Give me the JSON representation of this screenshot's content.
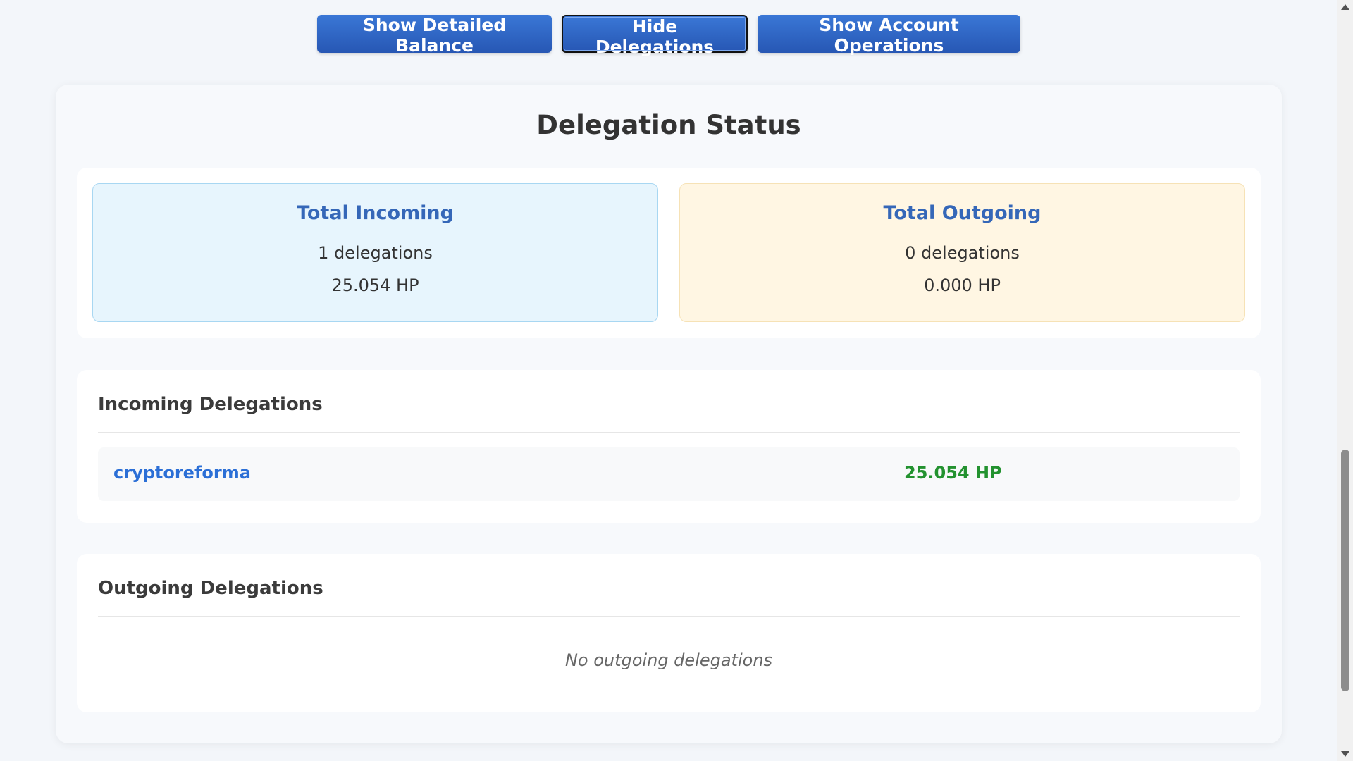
{
  "toolbar": {
    "detailed_balance_label": "Show Detailed Balance",
    "delegations_label": "Hide Delegations",
    "account_operations_label": "Show Account Operations"
  },
  "panel": {
    "title": "Delegation Status"
  },
  "summary": {
    "incoming": {
      "title": "Total Incoming",
      "count": "1 delegations",
      "amount": "25.054 HP"
    },
    "outgoing": {
      "title": "Total Outgoing",
      "count": "0 delegations",
      "amount": "0.000 HP"
    }
  },
  "incoming_section": {
    "title": "Incoming Delegations",
    "rows": [
      {
        "account": "cryptoreforma",
        "amount": "25.054 HP"
      }
    ]
  },
  "outgoing_section": {
    "title": "Outgoing Delegations",
    "empty_text": "No outgoing delegations"
  },
  "colors": {
    "button_primary": "#2f66c5",
    "incoming_card_bg": "#e7f5fd",
    "outgoing_card_bg": "#fff6e3",
    "card_title": "#3567b8",
    "account_link": "#2b6fd6",
    "amount_green": "#23922f"
  }
}
